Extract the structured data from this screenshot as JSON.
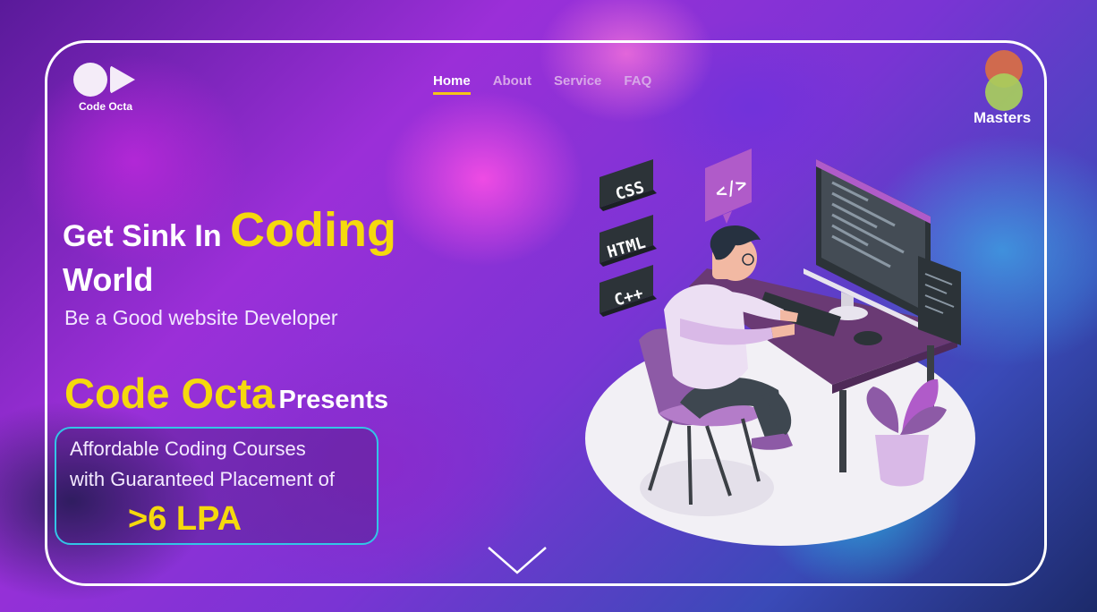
{
  "brand": {
    "logo_text": "Code Octa"
  },
  "nav": {
    "items": [
      {
        "label": "Home",
        "active": true
      },
      {
        "label": "About",
        "active": false
      },
      {
        "label": "Service",
        "active": false
      },
      {
        "label": "FAQ",
        "active": false
      }
    ]
  },
  "masters": {
    "label": "Masters",
    "colors": [
      "#d06a4e",
      "#a8ce5c"
    ]
  },
  "hero": {
    "headline_prefix": "Get Sink In",
    "headline_accent": "Coding",
    "headline_line2": "World",
    "subline": "Be a Good website Developer",
    "presents_brand": "Code Octa",
    "presents_word": "Presents",
    "offer_line1": "Affordable Coding Courses",
    "offer_line2": "with Guaranteed Placement of",
    "offer_highlight": ">6 LPA"
  },
  "illustration": {
    "tags": [
      "CSS",
      "HTML",
      "C++"
    ],
    "code_bubble": "</>"
  },
  "icons": {
    "scroll": "chevron-down-icon",
    "logo": "play-icon"
  },
  "colors": {
    "accent_yellow": "#f5d90d",
    "frame": "#ffffff",
    "offer_border": "#33c5e6",
    "nav_underline": "#f5c418"
  }
}
